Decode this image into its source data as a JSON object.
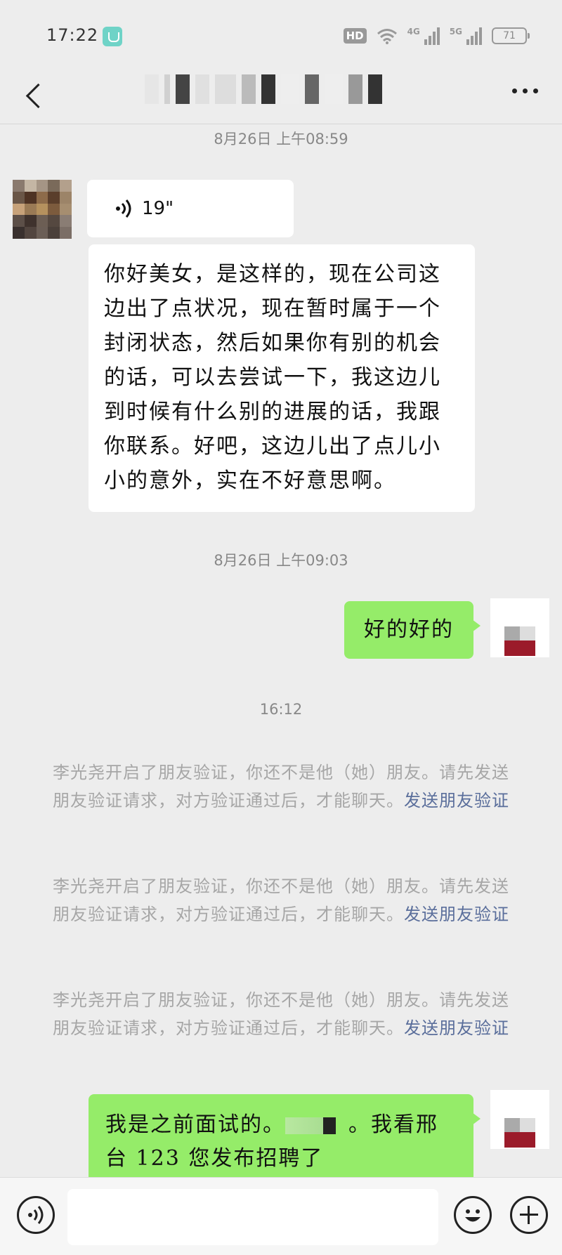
{
  "status_bar": {
    "time": "17:22",
    "hd_label": "HD",
    "net1": "4G",
    "net2": "5G",
    "battery": "71"
  },
  "header": {
    "title": "",
    "back_icon": "chevron-left-icon",
    "more_icon": "more-dots-icon"
  },
  "messages": {
    "ts1": "8月26日 上午08:59",
    "voice_duration": "19\"",
    "incoming_text": "你好美女，是这样的，现在公司这边出了点状况，现在暂时属于一个封闭状态，然后如果你有别的机会的话，可以去尝试一下，我这边儿到时候有什么别的进展的话，我跟你联系。好吧，这边儿出了点儿小小的意外，实在不好意思啊。",
    "ts2": "8月26日 上午09:03",
    "reply1": "好的好的",
    "ts3": "16:12",
    "sys1_text": "李光尧开启了朋友验证，你还不是他（她）朋友。请先发送朋友验证请求，对方验证通过后，才能聊天。",
    "sys1_link": "发送朋友验证",
    "sys2_text": "李光尧开启了朋友验证，你还不是他（她）朋友。请先发送朋友验证请求，对方验证通过后，才能聊天。",
    "sys2_link": "发送朋友验证",
    "sys3_text": "李光尧开启了朋友验证，你还不是他（她）朋友。请先发送朋友验证请求，对方验证通过后，才能聊天。",
    "sys3_link": "发送朋友验证",
    "reply2_a": "我是之前面试的。",
    "reply2_b": "。我看邢台 123 您发布招聘了"
  },
  "input_bar": {
    "voice_icon": "voice-input-icon",
    "emoji_icon": "emoji-icon",
    "plus_icon": "plus-icon"
  },
  "colors": {
    "background": "#ededed",
    "bubble_green": "#95ec69",
    "link": "#5a6e9b"
  }
}
